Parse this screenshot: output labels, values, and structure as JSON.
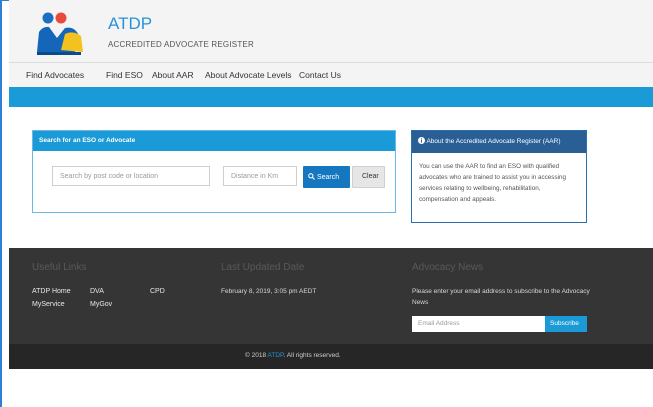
{
  "brand": {
    "title": "ATDP",
    "subtitle": "ACCREDITED ADVOCATE REGISTER",
    "logo_icon": "atdp-people-logo-icon"
  },
  "nav": {
    "items": [
      {
        "label": "Find Advocates"
      },
      {
        "label": "Find ESO"
      },
      {
        "label": "About AAR"
      },
      {
        "label": "About Advocate Levels"
      },
      {
        "label": "Contact Us"
      }
    ]
  },
  "search": {
    "heading": "Search for an ESO or Advocate",
    "location_placeholder": "Search by post code or location",
    "distance_placeholder": "Distance in Km",
    "search_label": "Search",
    "clear_label": "Clear"
  },
  "about": {
    "heading": "About the Accredited Advocate Register (AAR)",
    "body": "You can use the AAR to find an ESO with qualified advocates who are trained to assist you in accessing services relating to wellbeing, rehabilitation, compensation and appeals."
  },
  "footer": {
    "useful_links_heading": "Useful Links",
    "links": [
      "ATDP Home",
      "DVA",
      "CPD",
      "MyService",
      "MyGov"
    ],
    "last_updated_heading": "Last Updated Date",
    "last_updated_value": "February 8, 2019, 3:05 pm AEDT",
    "advocacy_heading": "Advocacy News",
    "advocacy_text": "Please enter your email address to subscribe to the Advocacy News",
    "email_placeholder": "Email Address",
    "subscribe_label": "Subscribe",
    "copyright_prefix": "© 2018 ",
    "copyright_link": "ATDP",
    "copyright_suffix": ". All rights reserved."
  },
  "colors": {
    "accent": "#1a9ad6",
    "button_primary": "#1677c1",
    "about_header": "#2a5f96",
    "footer_bg": "#353535",
    "copyright_bg": "#262626"
  }
}
